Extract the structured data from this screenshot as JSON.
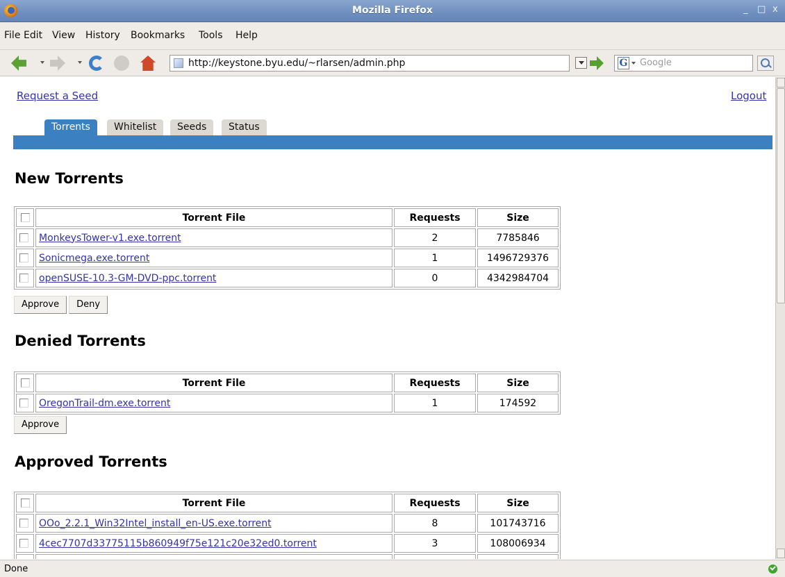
{
  "window": {
    "title": "Mozilla Firefox",
    "controls": [
      "_",
      "□",
      "x"
    ]
  },
  "menubar": [
    "File",
    "Edit",
    "View",
    "History",
    "Bookmarks",
    "Tools",
    "Help"
  ],
  "toolbar": {
    "url": "http://keystone.byu.edu/~rlarsen/admin.php",
    "search_placeholder": "Google",
    "search_engine_letter": "G"
  },
  "page": {
    "request_seed_link": "Request a Seed",
    "logout_link": "Logout",
    "tabs": [
      "Torrents",
      "Whitelist",
      "Seeds",
      "Status"
    ],
    "active_tab": "Torrents",
    "accent_color": "#3b80c0",
    "columns": [
      "Torrent File",
      "Requests",
      "Size"
    ],
    "sections": {
      "new": {
        "heading": "New Torrents",
        "rows": [
          {
            "file": "MonkeysTower-v1.exe.torrent",
            "requests": "2",
            "size": "7785846"
          },
          {
            "file": "Sonicmega.exe.torrent",
            "requests": "1",
            "size": "1496729376"
          },
          {
            "file": "openSUSE-10.3-GM-DVD-ppc.torrent",
            "requests": "0",
            "size": "4342984704"
          }
        ],
        "buttons": [
          "Approve",
          "Deny"
        ]
      },
      "denied": {
        "heading": "Denied Torrents",
        "rows": [
          {
            "file": "OregonTrail-dm.exe.torrent",
            "requests": "1",
            "size": "174592"
          }
        ],
        "buttons": [
          "Approve"
        ]
      },
      "approved": {
        "heading": "Approved Torrents",
        "rows": [
          {
            "file": "OOo_2.2.1_Win32Intel_install_en-US.exe.torrent",
            "requests": "8",
            "size": "101743716"
          },
          {
            "file": "4cec7707d33775115b860949f75e121c20e32ed0.torrent",
            "requests": "3",
            "size": "108006934"
          }
        ]
      }
    }
  },
  "status": {
    "text": "Done"
  }
}
